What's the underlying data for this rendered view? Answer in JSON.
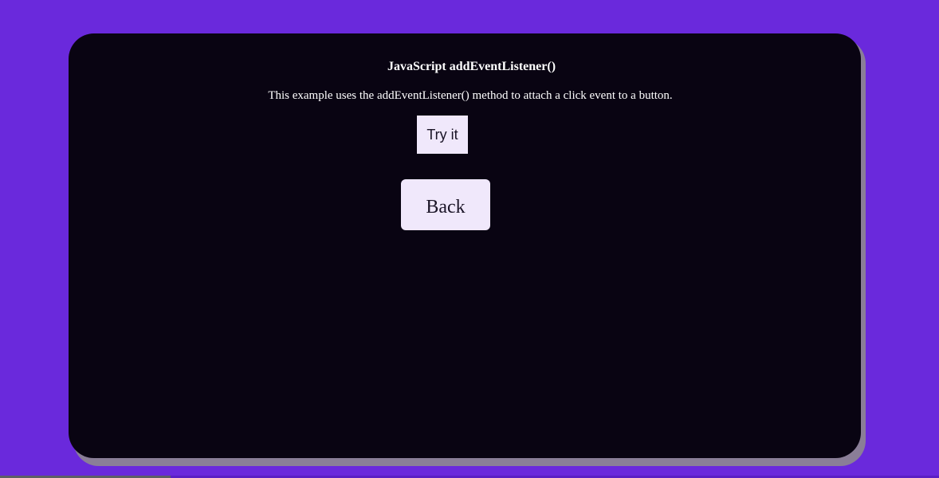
{
  "page": {
    "title": "JavaScript addEventListener()",
    "description": "This example uses the addEventListener() method to attach a click event to a button.",
    "try_button_label": "Try it",
    "back_button_label": "Back"
  },
  "colors": {
    "background": "#6a29dc",
    "card": "#090412",
    "card_shadow": "#8a7e97",
    "button_bg": "#f0e8fb",
    "button_text": "#1a1426",
    "text": "#ffffff"
  }
}
